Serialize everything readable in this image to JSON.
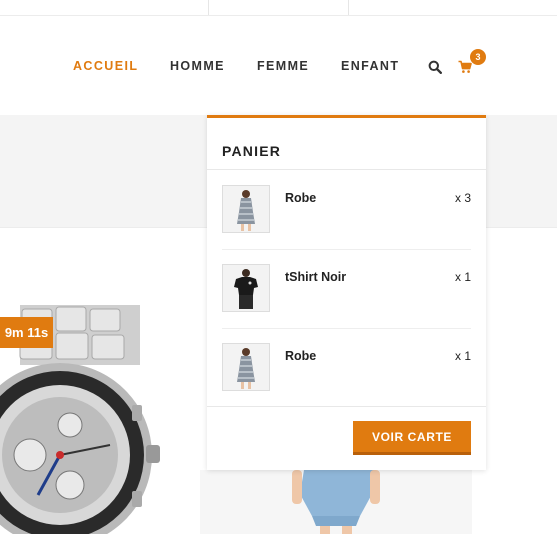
{
  "nav": {
    "items": [
      {
        "label": "ACCUEIL",
        "active": true
      },
      {
        "label": "HOMME",
        "active": false
      },
      {
        "label": "FEMME",
        "active": false
      },
      {
        "label": "ENFANT",
        "active": false
      }
    ],
    "search_icon": "search-icon",
    "cart_icon": "shopping-cart-icon",
    "cart_count": "3"
  },
  "promo": {
    "timer_text": "9m 11s"
  },
  "panier": {
    "title": "PANIER",
    "items": [
      {
        "name": "Robe",
        "qty": "x 3",
        "thumb": "dress-thumbnail"
      },
      {
        "name": "tShirt Noir",
        "qty": "x 1",
        "thumb": "tshirt-thumbnail"
      },
      {
        "name": "Robe",
        "qty": "x 1",
        "thumb": "dress-thumbnail"
      }
    ],
    "button_label": "VOIR CARTE"
  },
  "colors": {
    "accent": "#e07b10",
    "text": "#333333",
    "band": "#f4f4f4"
  }
}
